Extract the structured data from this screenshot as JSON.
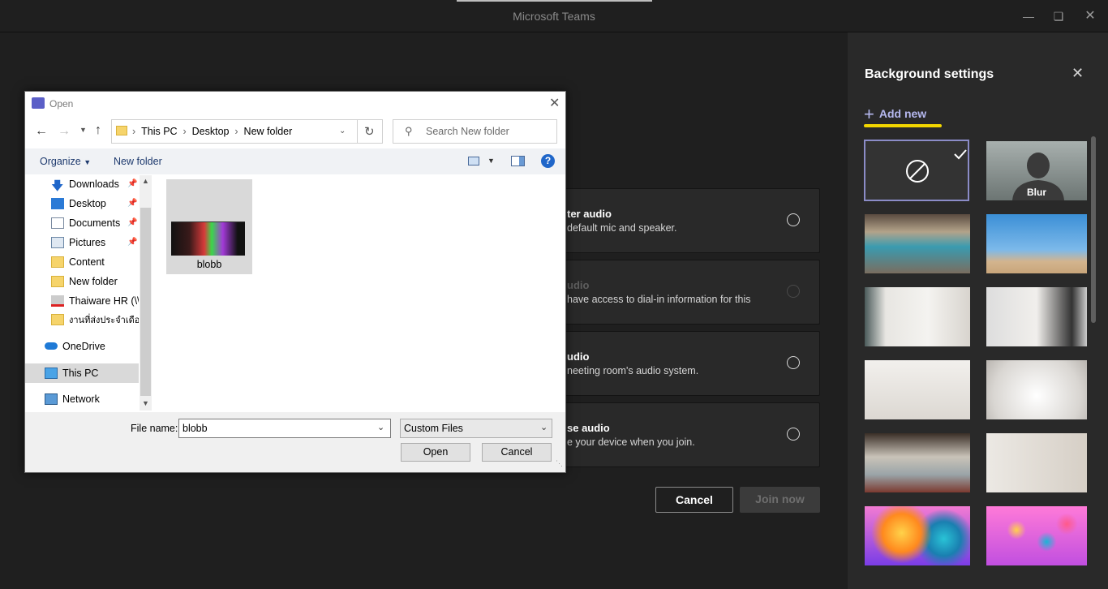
{
  "window": {
    "title": "Microsoft Teams"
  },
  "options": [
    {
      "title": "ter audio",
      "desc": "default mic and speaker."
    },
    {
      "title": "udio",
      "desc": "have access to dial-in information for this"
    },
    {
      "title": "udio",
      "desc": "neeting room's audio system."
    },
    {
      "title": "se audio",
      "desc": "e your device when you join."
    }
  ],
  "actions": {
    "cancel": "Cancel",
    "join": "Join now"
  },
  "background": {
    "title": "Background settings",
    "add_new": "Add new",
    "blur_label": "Blur"
  },
  "dialog": {
    "title": "Open",
    "path": [
      "This PC",
      "Desktop",
      "New folder"
    ],
    "search_placeholder": "Search New folder",
    "organize": "Organize",
    "new_folder": "New folder",
    "sidebar": [
      "Downloads",
      "Desktop",
      "Documents",
      "Pictures",
      "Content",
      "New folder",
      "Thaiware HR (\\\\",
      "งานที่ส่งประจำเดือน",
      "OneDrive",
      "This PC",
      "Network"
    ],
    "file_item": "blobb",
    "file_name_label": "File name:",
    "file_name_value": "blobb",
    "file_type": "Custom Files",
    "open_btn": "Open",
    "cancel_btn": "Cancel"
  }
}
